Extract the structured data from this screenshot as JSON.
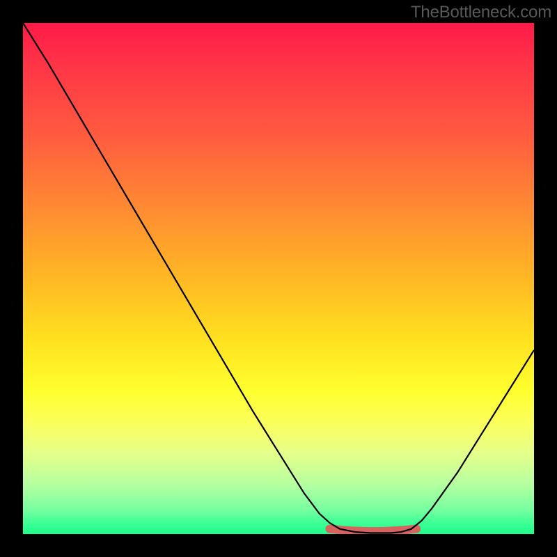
{
  "watermark": "TheBottleneck.com",
  "chart_data": {
    "type": "line",
    "title": "",
    "xlabel": "",
    "ylabel": "",
    "ylim": [
      0,
      100
    ],
    "xlim": [
      0,
      100
    ],
    "description": "Bottleneck curve over rainbow gradient; minimum band highlighted in muted red near x≈62–76.",
    "series": [
      {
        "name": "bottleneck-curve",
        "x": [
          0,
          5,
          10,
          15,
          20,
          25,
          30,
          35,
          40,
          45,
          50,
          55,
          58,
          60,
          62,
          65,
          68,
          70,
          72,
          74,
          76,
          78,
          80,
          85,
          90,
          95,
          100
        ],
        "y": [
          100,
          92,
          83.5,
          75,
          66.5,
          58,
          49.5,
          41,
          32.5,
          24,
          16,
          8,
          4,
          2.2,
          1,
          0.4,
          0.2,
          0.2,
          0.2,
          0.4,
          1,
          2.6,
          5,
          12,
          20,
          28,
          36
        ]
      }
    ],
    "highlight_band": {
      "x_start": 60,
      "x_end": 77,
      "y": 0.6
    },
    "gradient_stops": [
      {
        "pos": 0,
        "color": "#ff1a47"
      },
      {
        "pos": 22,
        "color": "#ff5b3f"
      },
      {
        "pos": 50,
        "color": "#ffb824"
      },
      {
        "pos": 72,
        "color": "#ffff2e"
      },
      {
        "pos": 90,
        "color": "#b8ff9f"
      },
      {
        "pos": 100,
        "color": "#1fff8c"
      }
    ]
  }
}
